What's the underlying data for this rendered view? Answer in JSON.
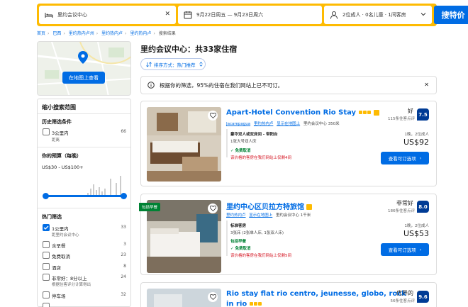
{
  "search": {
    "destination": "里约会议中心",
    "dates": "9月22日周五  —  9月23日周六",
    "guests": "2位成人 · 0名儿童 · 1间客房",
    "button": "搜特价"
  },
  "breadcrumb": [
    "首页",
    "巴西",
    "里约热内卢州",
    "里约热内卢",
    "里约热内卢",
    "搜索结果"
  ],
  "map": {
    "button": "在地图上查看"
  },
  "filters": {
    "title": "缩小搜索范围",
    "history_title": "历史筛选条件",
    "history": [
      {
        "label": "3公里内",
        "sub": "距离",
        "count": "66"
      }
    ],
    "budget_title": "你的预算（每晚）",
    "budget_range": "US$30 - US$100+",
    "popular_title": "热门筛选",
    "popular": [
      {
        "label": "1公里内",
        "sub": "距里约会议中心",
        "count": "33",
        "checked": true
      },
      {
        "label": "含早餐",
        "count": "3",
        "checked": false
      },
      {
        "label": "免费取消",
        "count": "23",
        "checked": false
      },
      {
        "label": "酒店",
        "count": "8",
        "checked": false
      },
      {
        "label": "非常好：8分以上",
        "sub": "根据住客评分计算得出",
        "count": "24",
        "checked": false
      },
      {
        "label": "停车场",
        "count": "32",
        "checked": false
      }
    ]
  },
  "results": {
    "title": "里约会议中心：共33家住宿",
    "sort": "排序方式：热门推荐",
    "notice": "根据你的筛选，95%的住宿在我们网站上已不可订。"
  },
  "cards": [
    {
      "name": "Apart-Hotel Convention Rio Stay",
      "loc_link1": "Jacarepagua",
      "loc_link2": "里约热内卢",
      "loc_link3": "显示在地图上",
      "distance": "里约会议中心 350米",
      "room_name": "豪华双人或双床间 - 带阳台",
      "room_bed": "1张大号双人床",
      "free_cancel": "✓ 免费取消",
      "warning": "该价格的客房在我们网站上仅剩4间",
      "rating_label": "好",
      "review_count": "115条住客点评",
      "score": "7.5",
      "nights": "1晚，2位成人",
      "price": "US$92",
      "button": "查看可订选项",
      "badge": ""
    },
    {
      "name": "里约中心区贝拉方特旅馆",
      "loc_link1": "里约热内卢",
      "loc_link2": "显示在地图上",
      "loc_link3": "",
      "distance": "里约会议中心 1千米",
      "room_name": "标准客房",
      "room_bed": "3张床 (2张单人床, 1张双人床)",
      "breakfast": "包括早餐",
      "free_cancel": "✓ 免费取消",
      "warning": "该价格的客房在我们网站上仅剩5间",
      "rating_label": "非常好",
      "review_count": "186条住客点评",
      "score": "8.0",
      "nights": "1晚，2位成人",
      "price": "US$53",
      "button": "查看可订选项",
      "badge": "包括早餐"
    },
    {
      "name": "Rio stay flat rio centro, jeunesse, globo, rock",
      "name2": "in rio",
      "rating_label": "优异的",
      "review_count": "56条住客点评",
      "score": "9.6"
    }
  ],
  "colors": {
    "brand": "#006ce4",
    "accent": "#febb02",
    "score": "#003b95",
    "green": "#008234",
    "red": "#d4111e"
  }
}
